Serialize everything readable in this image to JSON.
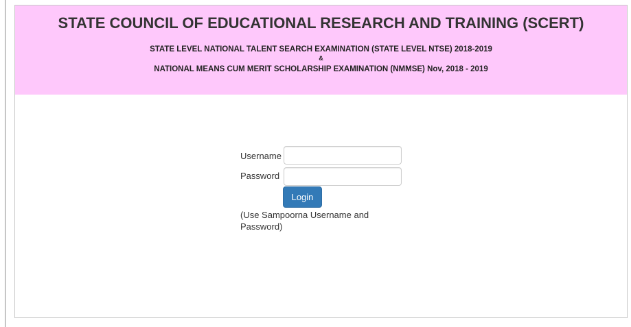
{
  "header": {
    "title": "STATE COUNCIL OF EDUCATIONAL RESEARCH AND TRAINING (SCERT)",
    "subtitle_line1": "STATE LEVEL NATIONAL TALENT SEARCH EXAMINATION (STATE LEVEL NTSE) 2018-2019",
    "subtitle_amp": "&",
    "subtitle_line2": "NATIONAL MEANS CUM MERIT SCHOLARSHIP EXAMINATION (NMMSE) Nov, 2018 - 2019",
    "background_color": "#fec8fb"
  },
  "login_form": {
    "username_label": "Username",
    "username_value": "",
    "password_label": "Password",
    "password_value": "",
    "login_button_label": "Login",
    "button_color": "#337ab7",
    "note_line1": "(Use Sampoorna Username and",
    "note_line2": "Password)"
  }
}
